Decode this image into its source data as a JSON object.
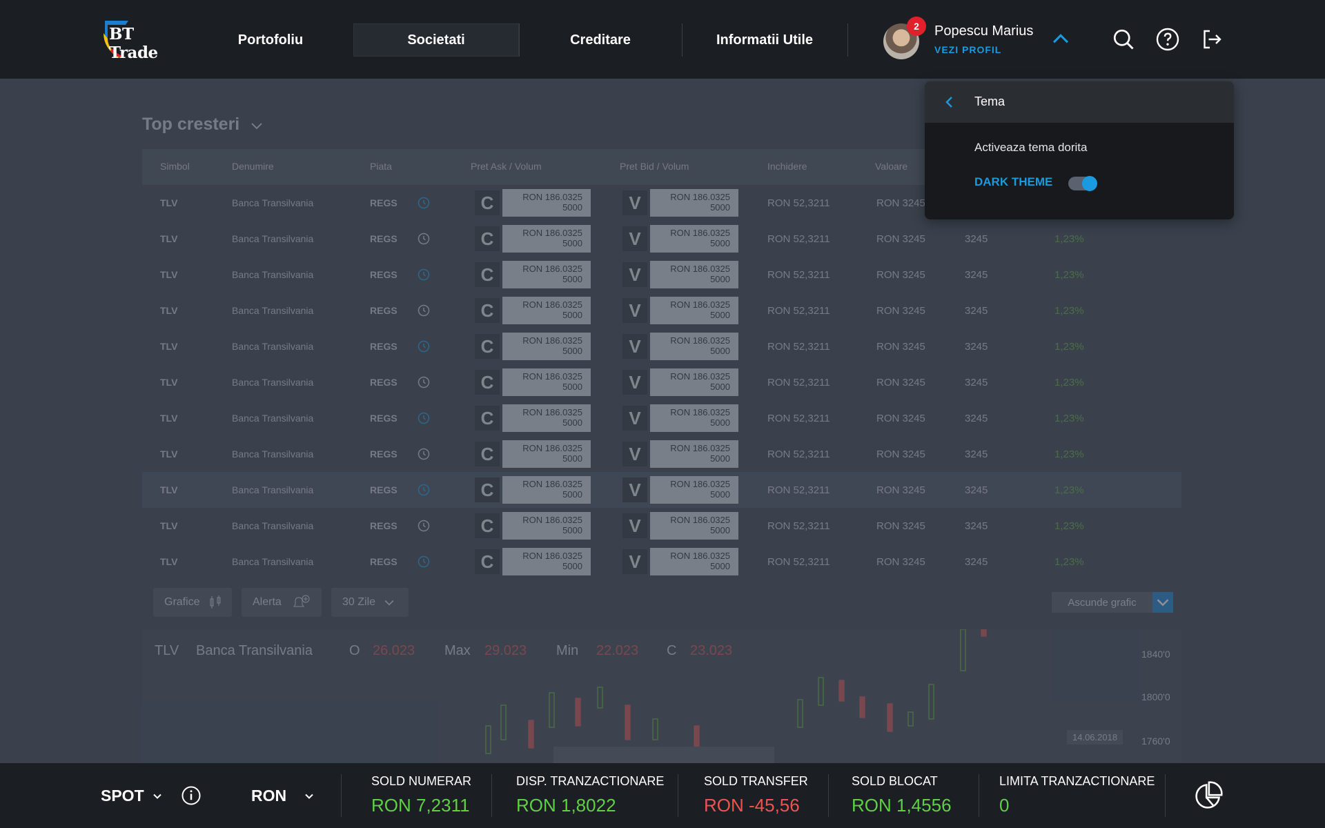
{
  "brand": {
    "logo_text": "BT Trade"
  },
  "nav": [
    {
      "label": "Portofoliu",
      "active": false
    },
    {
      "label": "Societati",
      "active": true
    },
    {
      "label": "Creditare",
      "active": false
    },
    {
      "label": "Informatii Utile",
      "active": false
    }
  ],
  "user": {
    "name": "Popescu Marius",
    "profile_link": "VEZI PROFIL",
    "notifications": "2"
  },
  "header_icons": [
    "chevron-up-icon",
    "search-icon",
    "help-icon",
    "logout-icon"
  ],
  "theme_menu": {
    "title": "Tema",
    "description": "Activeaza tema dorita",
    "option_label": "DARK THEME",
    "dark_theme_enabled": true
  },
  "page": {
    "title": "Top cresteri"
  },
  "table": {
    "columns": [
      "Simbol",
      "Denumire",
      "Piata",
      "Pret Ask / Volum",
      "Pret Bid / Volum",
      "Inchidere",
      "Valoare"
    ],
    "rows": [
      {
        "symbol": "TLV",
        "name": "Banca Transilvania",
        "market": "REGS",
        "ask_letter": "C",
        "ask_price": "RON 186.0325",
        "ask_volume": "5000",
        "bid_letter": "V",
        "bid_price": "RON 186.0325",
        "bid_volume": "5000",
        "close": "RON 52,3211",
        "value": "RON 3245",
        "extra": "3245",
        "change": "1,23%"
      },
      {
        "symbol": "TLV",
        "name": "Banca Transilvania",
        "market": "REGS",
        "ask_letter": "C",
        "ask_price": "RON 186.0325",
        "ask_volume": "5000",
        "bid_letter": "V",
        "bid_price": "RON 186.0325",
        "bid_volume": "5000",
        "close": "RON 52,3211",
        "value": "RON 3245",
        "extra": "3245",
        "change": "1,23%"
      },
      {
        "symbol": "TLV",
        "name": "Banca Transilvania",
        "market": "REGS",
        "ask_letter": "C",
        "ask_price": "RON 186.0325",
        "ask_volume": "5000",
        "bid_letter": "V",
        "bid_price": "RON 186.0325",
        "bid_volume": "5000",
        "close": "RON 52,3211",
        "value": "RON 3245",
        "extra": "3245",
        "change": "1,23%"
      },
      {
        "symbol": "TLV",
        "name": "Banca Transilvania",
        "market": "REGS",
        "ask_letter": "C",
        "ask_price": "RON 186.0325",
        "ask_volume": "5000",
        "bid_letter": "V",
        "bid_price": "RON 186.0325",
        "bid_volume": "5000",
        "close": "RON 52,3211",
        "value": "RON 3245",
        "extra": "3245",
        "change": "1,23%"
      },
      {
        "symbol": "TLV",
        "name": "Banca Transilvania",
        "market": "REGS",
        "ask_letter": "C",
        "ask_price": "RON 186.0325",
        "ask_volume": "5000",
        "bid_letter": "V",
        "bid_price": "RON 186.0325",
        "bid_volume": "5000",
        "close": "RON 52,3211",
        "value": "RON 3245",
        "extra": "3245",
        "change": "1,23%"
      },
      {
        "symbol": "TLV",
        "name": "Banca Transilvania",
        "market": "REGS",
        "ask_letter": "C",
        "ask_price": "RON 186.0325",
        "ask_volume": "5000",
        "bid_letter": "V",
        "bid_price": "RON 186.0325",
        "bid_volume": "5000",
        "close": "RON 52,3211",
        "value": "RON 3245",
        "extra": "3245",
        "change": "1,23%"
      },
      {
        "symbol": "TLV",
        "name": "Banca Transilvania",
        "market": "REGS",
        "ask_letter": "C",
        "ask_price": "RON 186.0325",
        "ask_volume": "5000",
        "bid_letter": "V",
        "bid_price": "RON 186.0325",
        "bid_volume": "5000",
        "close": "RON 52,3211",
        "value": "RON 3245",
        "extra": "3245",
        "change": "1,23%"
      },
      {
        "symbol": "TLV",
        "name": "Banca Transilvania",
        "market": "REGS",
        "ask_letter": "C",
        "ask_price": "RON 186.0325",
        "ask_volume": "5000",
        "bid_letter": "V",
        "bid_price": "RON 186.0325",
        "bid_volume": "5000",
        "close": "RON 52,3211",
        "value": "RON 3245",
        "extra": "3245",
        "change": "1,23%"
      },
      {
        "symbol": "TLV",
        "name": "Banca Transilvania",
        "market": "REGS",
        "ask_letter": "C",
        "ask_price": "RON 186.0325",
        "ask_volume": "5000",
        "bid_letter": "V",
        "bid_price": "RON 186.0325",
        "bid_volume": "5000",
        "close": "RON 52,3211",
        "value": "RON 3245",
        "extra": "3245",
        "change": "1,23%"
      },
      {
        "symbol": "TLV",
        "name": "Banca Transilvania",
        "market": "REGS",
        "ask_letter": "C",
        "ask_price": "RON 186.0325",
        "ask_volume": "5000",
        "bid_letter": "V",
        "bid_price": "RON 186.0325",
        "bid_volume": "5000",
        "close": "RON 52,3211",
        "value": "RON 3245",
        "extra": "3245",
        "change": "1,23%"
      },
      {
        "symbol": "TLV",
        "name": "Banca Transilvania",
        "market": "REGS",
        "ask_letter": "C",
        "ask_price": "RON 186.0325",
        "ask_volume": "5000",
        "bid_letter": "V",
        "bid_price": "RON 186.0325",
        "bid_volume": "5000",
        "close": "RON 52,3211",
        "value": "RON 3245",
        "extra": "3245",
        "change": "1,23%"
      }
    ],
    "highlighted_row": 8
  },
  "toolbar": {
    "grafice": "Grafice",
    "alerta": "Alerta",
    "period": "30 Zile",
    "hide_chart": "Ascunde grafic"
  },
  "chart_panel": {
    "symbol": "TLV",
    "name": "Banca Transilvania",
    "open_label": "O",
    "open": "26.023",
    "max_label": "Max",
    "max": "29.023",
    "min_label": "Min",
    "min": "22.023",
    "close_label": "C",
    "close": "23.023",
    "y_ticks": [
      "1840'0",
      "1800'0",
      "1760'0"
    ],
    "date_tag": "14.06.2018"
  },
  "footer": {
    "market": "SPOT",
    "currency": "RON",
    "balances": [
      {
        "label": "SOLD NUMERAR",
        "value": "RON 7,2311",
        "color": "#5fd046"
      },
      {
        "label": "DISP. TRANZACTIONARE",
        "value": "RON 1,8022",
        "color": "#5fd046"
      },
      {
        "label": "SOLD TRANSFER",
        "value": "RON -45,56",
        "color": "#ef5350"
      },
      {
        "label": "SOLD BLOCAT",
        "value": "RON 1,4556",
        "color": "#5fd046"
      },
      {
        "label": "LIMITA TRANZACTIONARE",
        "value": "0",
        "color": "#5fd046"
      }
    ]
  }
}
